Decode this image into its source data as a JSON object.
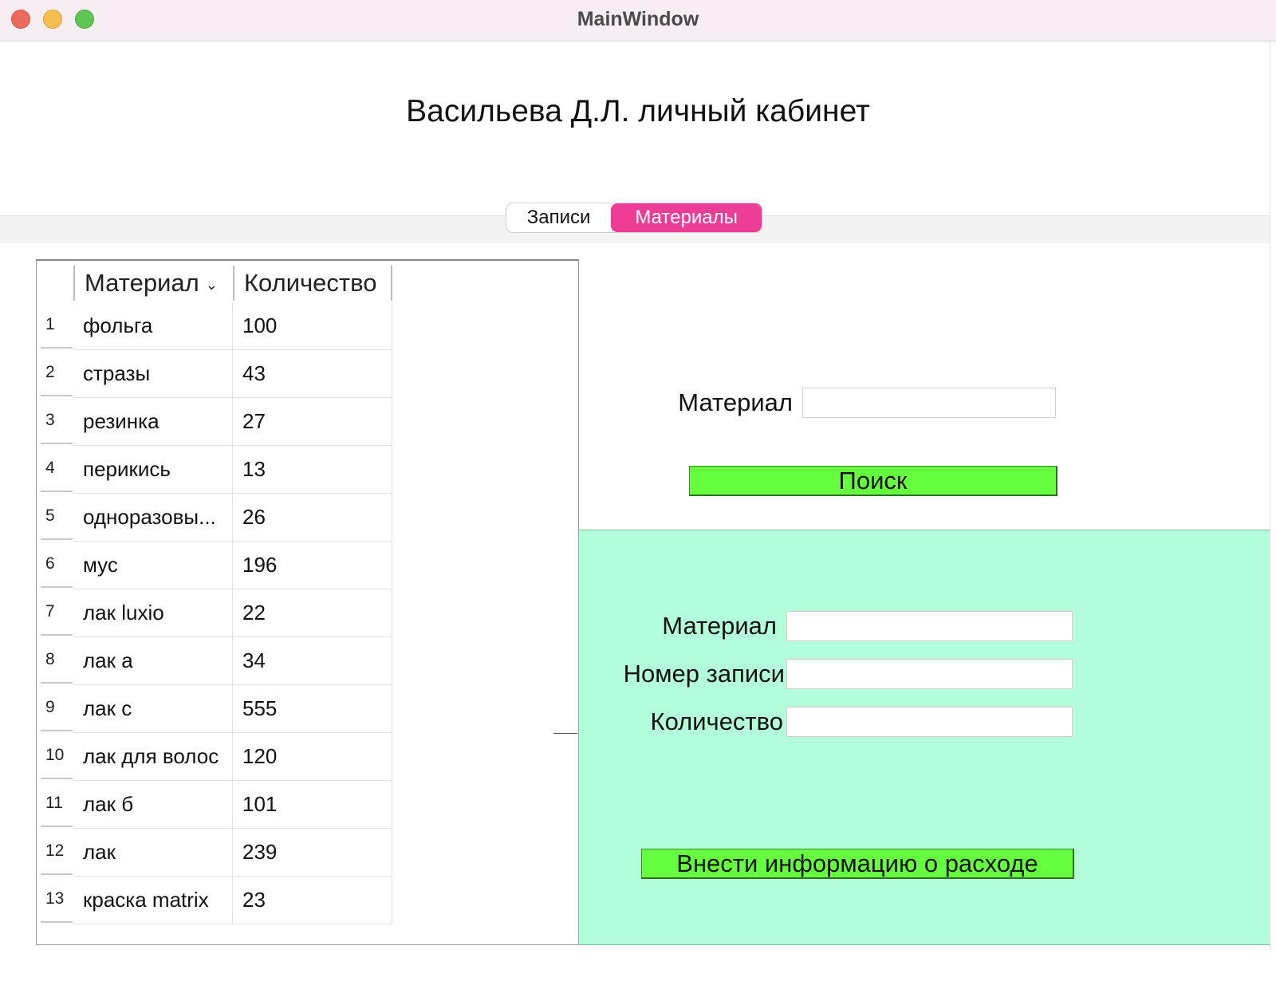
{
  "window": {
    "title": "MainWindow"
  },
  "page": {
    "heading": "Васильева Д.Л. личный кабинет"
  },
  "tabs": [
    {
      "label": "Записи",
      "selected": false
    },
    {
      "label": "Материалы",
      "selected": true
    }
  ],
  "table": {
    "headers": [
      "Материал",
      "Количество"
    ],
    "rows": [
      {
        "n": "1",
        "material": "фольга",
        "qty": "100"
      },
      {
        "n": "2",
        "material": "стразы",
        "qty": "43"
      },
      {
        "n": "3",
        "material": "резинка",
        "qty": "27"
      },
      {
        "n": "4",
        "material": "перикись",
        "qty": "13"
      },
      {
        "n": "5",
        "material": "одноразовы...",
        "qty": "26"
      },
      {
        "n": "6",
        "material": "мус",
        "qty": "196"
      },
      {
        "n": "7",
        "material": "лак luxio",
        "qty": "22"
      },
      {
        "n": "8",
        "material": "лак а",
        "qty": "34"
      },
      {
        "n": "9",
        "material": "лак с",
        "qty": "555"
      },
      {
        "n": "10",
        "material": "лак для волос",
        "qty": "120"
      },
      {
        "n": "11",
        "material": "лак б",
        "qty": "101"
      },
      {
        "n": "12",
        "material": "лак",
        "qty": "239"
      },
      {
        "n": "13",
        "material": "краска matrix",
        "qty": "23"
      }
    ]
  },
  "search": {
    "label": "Материал",
    "value": "",
    "button_label": "Поиск"
  },
  "expense": {
    "material_label": "Материал",
    "record_label": "Номер записи",
    "quantity_label": "Количество",
    "material_value": "",
    "record_value": "",
    "quantity_value": "",
    "button_label": "Внести информацию о расходе"
  },
  "colors": {
    "tab_selected": "#ee3d96",
    "button": "#66ff3f",
    "panel": "#b3ffdc"
  }
}
